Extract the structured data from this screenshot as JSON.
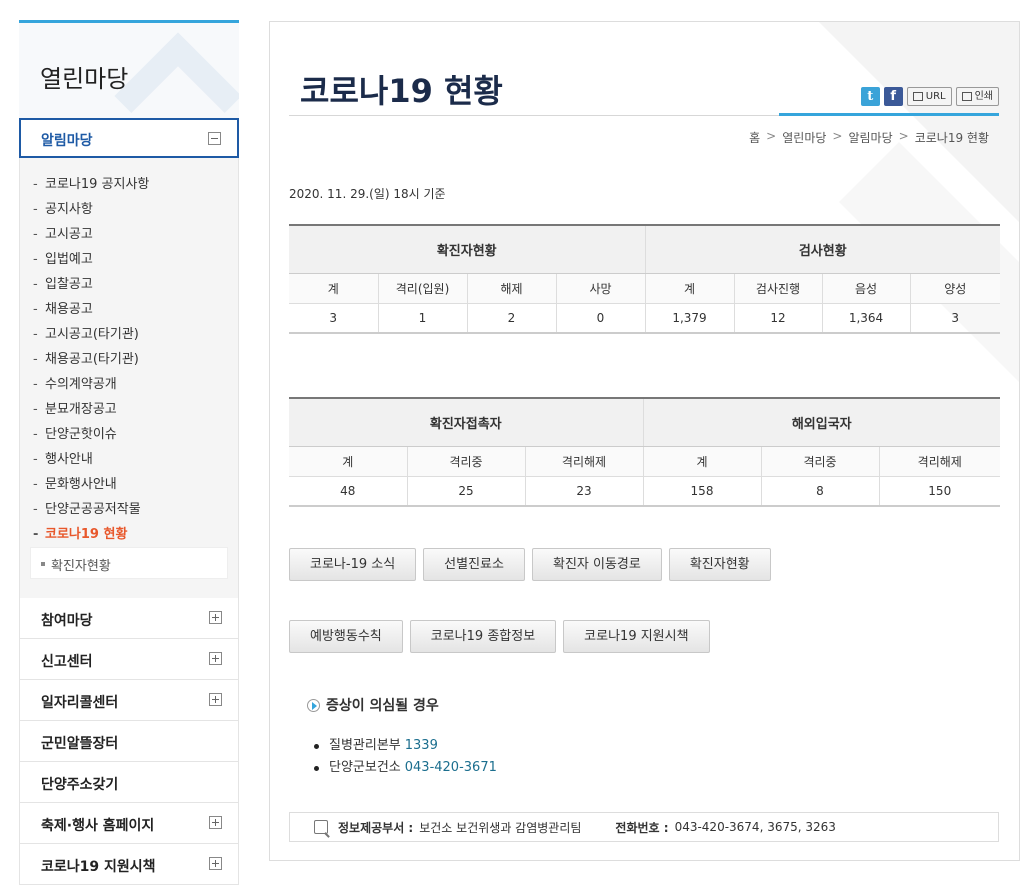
{
  "sidebar": {
    "title": "열린마당",
    "active_section": "알림마당",
    "submenu": [
      "코로나19 공지사항",
      "공지사항",
      "고시공고",
      "입법예고",
      "입찰공고",
      "채용공고",
      "고시공고(타기관)",
      "채용공고(타기관)",
      "수의계약공개",
      "분묘개장공고",
      "단양군핫이슈",
      "행사안내",
      "문화행사안내",
      "단양군공공저작물",
      "코로나19 현황"
    ],
    "current_item": "코로나19 현황",
    "subsub_item": "확진자현황",
    "sections": [
      {
        "label": "참여마당",
        "expandable": true
      },
      {
        "label": "신고센터",
        "expandable": true
      },
      {
        "label": "일자리콜센터",
        "expandable": true
      },
      {
        "label": "군민알뜰장터",
        "expandable": false
      },
      {
        "label": "단양주소갖기",
        "expandable": false
      },
      {
        "label": "축제·행사 홈페이지",
        "expandable": true
      },
      {
        "label": "코로나19 지원시책",
        "expandable": true
      }
    ]
  },
  "header": {
    "title": "코로나19 현황",
    "share": {
      "url_label": "URL",
      "print_label": "인쇄"
    },
    "breadcrumb": [
      "홈",
      "열린마당",
      "알림마당",
      "코로나19 현황"
    ]
  },
  "date_text": "2020. 11. 29.(일) 18시 기준",
  "table1": {
    "groups": [
      "확진자현황",
      "검사현황"
    ],
    "headers": [
      "계",
      "격리(입원)",
      "해제",
      "사망",
      "계",
      "검사진행",
      "음성",
      "양성"
    ],
    "values": [
      "3",
      "1",
      "2",
      "0",
      "1,379",
      "12",
      "1,364",
      "3"
    ]
  },
  "table2": {
    "groups": [
      "확진자접촉자",
      "해외입국자"
    ],
    "headers": [
      "계",
      "격리중",
      "격리해제",
      "계",
      "격리중",
      "격리해제"
    ],
    "values": [
      "48",
      "25",
      "23",
      "158",
      "8",
      "150"
    ]
  },
  "buttons_row1": [
    "코로나-19 소식",
    "선별진료소",
    "확진자 이동경로",
    "확진자현황"
  ],
  "buttons_row2": [
    "예방행동수칙",
    "코로나19 종합정보",
    "코로나19 지원시책"
  ],
  "symptom": {
    "heading": "증상이 의심될 경우",
    "contacts": [
      {
        "name": "질병관리본부",
        "number": "1339"
      },
      {
        "name": "단양군보건소",
        "number": "043-420-3671"
      }
    ]
  },
  "footer": {
    "dept_label": "정보제공부서 :",
    "dept_value": "보건소 보건위생과 감염병관리팀",
    "phone_label": "전화번호 :",
    "phone_value": "043-420-3674, 3675, 3263"
  }
}
